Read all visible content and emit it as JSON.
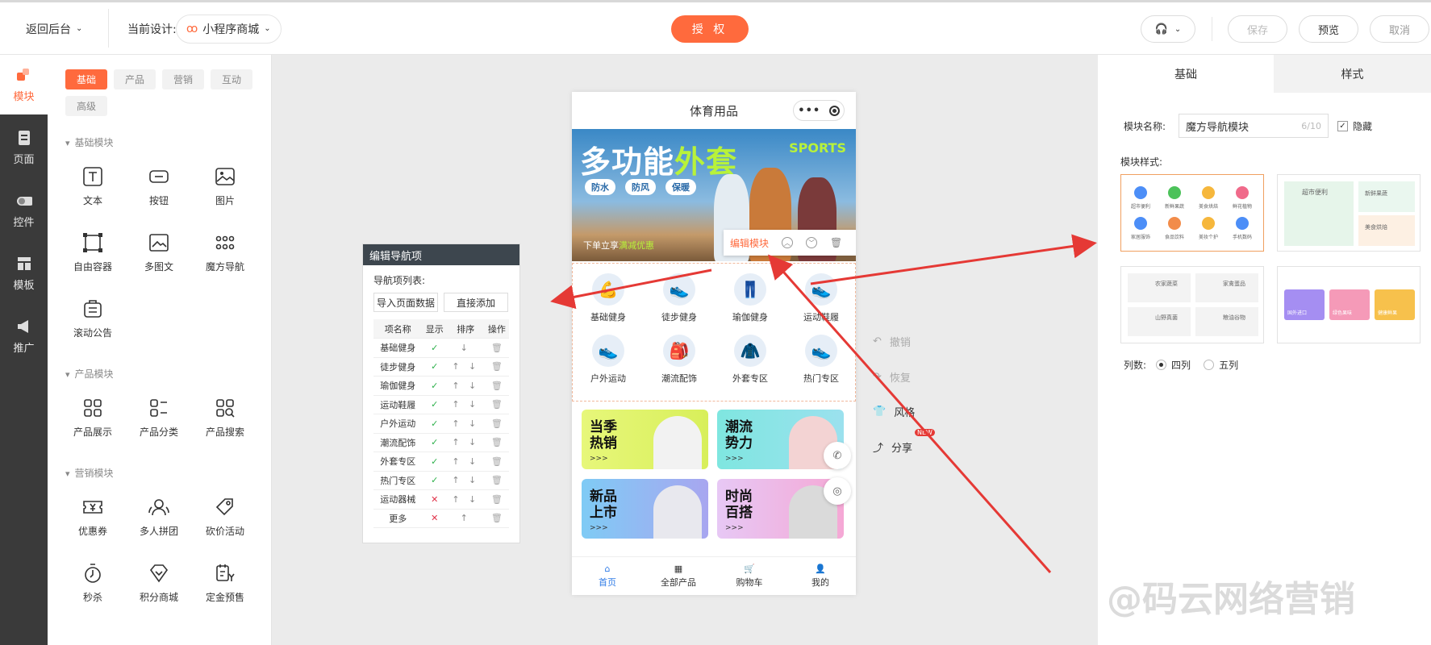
{
  "topbar": {
    "back_label": "返回后台",
    "current_design_label": "当前设计:",
    "design_value": "小程序商城",
    "auth_label": "授 权",
    "save_label": "保存",
    "preview_label": "预览",
    "cancel_label": "取消"
  },
  "left_nav": [
    {
      "label": "模块",
      "icon": "module-icon"
    },
    {
      "label": "页面",
      "icon": "page-icon"
    },
    {
      "label": "控件",
      "icon": "toggle-icon"
    },
    {
      "label": "模板",
      "icon": "template-icon"
    },
    {
      "label": "推广",
      "icon": "megaphone-icon"
    }
  ],
  "module_panel": {
    "tags": [
      "基础",
      "产品",
      "营销",
      "互动",
      "高级"
    ],
    "sections": [
      "基础模块",
      "产品模块",
      "营销模块"
    ],
    "basic": [
      "文本",
      "按钮",
      "图片",
      "自由容器",
      "多图文",
      "魔方导航",
      "滚动公告"
    ],
    "product": [
      "产品展示",
      "产品分类",
      "产品搜索"
    ],
    "marketing": [
      "优惠券",
      "多人拼团",
      "砍价活动",
      "秒杀",
      "积分商城",
      "定金预售"
    ]
  },
  "phone": {
    "title": "体育用品",
    "banner_title_a": "多功能",
    "banner_title_b": "外套",
    "banner_sports": "SPORTS",
    "chips": [
      "防水",
      "防风",
      "保暖"
    ],
    "banner_bottom_a": "下单立享",
    "banner_bottom_b": "满减优惠",
    "edit_module": "编辑模块",
    "nav_items": [
      "基础健身",
      "徒步健身",
      "瑜伽健身",
      "运动鞋履",
      "户外运动",
      "潮流配饰",
      "外套专区",
      "热门专区"
    ],
    "cards": [
      {
        "title": "当季\n热销",
        "arrows": ">>>"
      },
      {
        "title": "潮流\n势力",
        "arrows": ">>>"
      },
      {
        "title": "新品\n上市",
        "arrows": ">>>"
      },
      {
        "title": "时尚\n百搭",
        "arrows": ">>>"
      }
    ],
    "tabs": [
      "首页",
      "全部产品",
      "购物车",
      "我的"
    ]
  },
  "edit_nav": {
    "title": "编辑导航项",
    "list_label": "导航项列表:",
    "import_btn": "导入页面数据",
    "add_btn": "直接添加",
    "headers": [
      "项名称",
      "显示",
      "排序",
      "操作"
    ],
    "rows": [
      {
        "name": "基础健身",
        "show": "✓",
        "sort": "↓"
      },
      {
        "name": "徒步健身",
        "show": "✓",
        "sort": "↑ ↓"
      },
      {
        "name": "瑜伽健身",
        "show": "✓",
        "sort": "↑ ↓"
      },
      {
        "name": "运动鞋履",
        "show": "✓",
        "sort": "↑ ↓"
      },
      {
        "name": "户外运动",
        "show": "✓",
        "sort": "↑ ↓"
      },
      {
        "name": "潮流配饰",
        "show": "✓",
        "sort": "↑ ↓"
      },
      {
        "name": "外套专区",
        "show": "✓",
        "sort": "↑ ↓"
      },
      {
        "name": "热门专区",
        "show": "✓",
        "sort": "↑ ↓"
      },
      {
        "name": "运动器械",
        "show": "✕",
        "sort": "↑ ↓"
      },
      {
        "name": "更多",
        "show": "✕",
        "sort": "↑"
      }
    ]
  },
  "canvas_actions": {
    "undo": "撤销",
    "redo": "恢复",
    "style": "风格",
    "share": "分享",
    "new_badge": "NEW"
  },
  "right_panel": {
    "tabs": [
      "基础",
      "样式"
    ],
    "module_name_label": "模块名称:",
    "module_name_value": "魔方导航模块",
    "char_count": "6/10",
    "hide_label": "隐藏",
    "style_label": "模块样式:",
    "columns_label": "列数:",
    "col4": "四列",
    "col5": "五列",
    "style1_items": [
      "超市便利",
      "新鲜果蔬",
      "美食烘焙",
      "鲜花植物",
      "家居服饰",
      "食品饮料",
      "美妆个护",
      "手机数码"
    ],
    "style2_items": [
      "超市便利",
      "新鲜果蔬",
      "美食烘焙"
    ],
    "style3_items": [
      "农家蔬菜",
      "家禽蛋品",
      "山野真菌",
      "粮油谷物"
    ],
    "style4_items": [
      "国外进口",
      "绿色果味",
      "健康鲜果"
    ]
  },
  "watermark": "@码云网络营销",
  "colors": {
    "accent": "#ff6a3d",
    "nav_dark": "#3a3a3a",
    "tab_blue": "#2f7be6",
    "arrow_red": "#e53935"
  }
}
